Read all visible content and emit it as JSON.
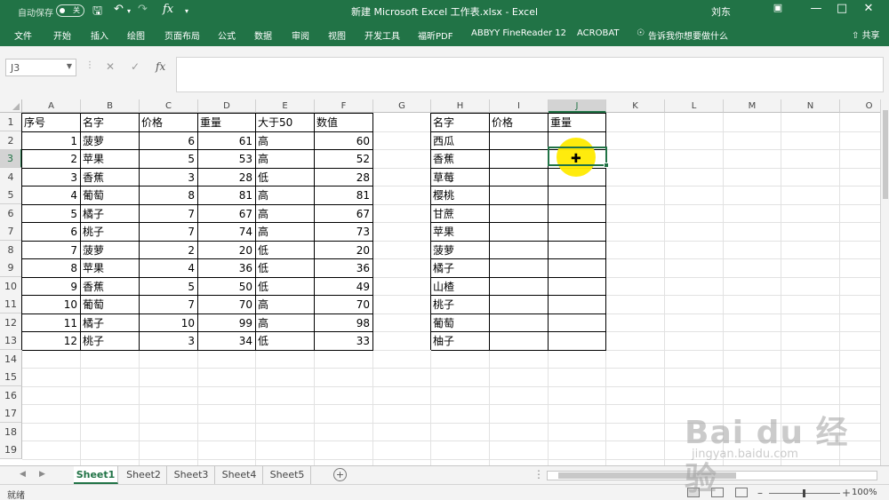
{
  "titlebar": {
    "autosave_label": "自动保存",
    "autosave_state": "关",
    "title": "新建 Microsoft Excel 工作表.xlsx  -  Excel",
    "user": "刘东",
    "icons": [
      "save-icon",
      "undo-icon",
      "redo-icon",
      "function-icon",
      "customize-icon",
      "ribbon-display-icon",
      "minimize-icon",
      "maximize-icon",
      "close-icon"
    ]
  },
  "ribbon": {
    "tabs": [
      "文件",
      "开始",
      "插入",
      "绘图",
      "页面布局",
      "公式",
      "数据",
      "审阅",
      "视图",
      "开发工具",
      "福昕PDF",
      "ABBYY FineReader 12",
      "ACROBAT",
      "告诉我你想要做什么"
    ],
    "share": "共享"
  },
  "namebox": {
    "value": "J3"
  },
  "formula": {
    "value": ""
  },
  "columns": [
    "A",
    "B",
    "C",
    "D",
    "E",
    "F",
    "G",
    "H",
    "I",
    "J",
    "K",
    "L",
    "M",
    "N",
    "O"
  ],
  "rows": [
    "1",
    "2",
    "3",
    "4",
    "5",
    "6",
    "7",
    "8",
    "9",
    "10",
    "11",
    "12",
    "13",
    "14",
    "15",
    "16",
    "17",
    "18",
    "19"
  ],
  "table1": {
    "headers": [
      "序号",
      "名字",
      "价格",
      "重量",
      "大于50",
      "数值"
    ],
    "rows": [
      [
        "1",
        "菠萝",
        "6",
        "61",
        "高",
        "60"
      ],
      [
        "2",
        "苹果",
        "5",
        "53",
        "高",
        "52"
      ],
      [
        "3",
        "香蕉",
        "3",
        "28",
        "低",
        "28"
      ],
      [
        "4",
        "葡萄",
        "8",
        "81",
        "高",
        "81"
      ],
      [
        "5",
        "橘子",
        "7",
        "67",
        "高",
        "67"
      ],
      [
        "6",
        "桃子",
        "7",
        "74",
        "高",
        "73"
      ],
      [
        "7",
        "菠萝",
        "2",
        "20",
        "低",
        "20"
      ],
      [
        "8",
        "苹果",
        "4",
        "36",
        "低",
        "36"
      ],
      [
        "9",
        "香蕉",
        "5",
        "50",
        "低",
        "49"
      ],
      [
        "10",
        "葡萄",
        "7",
        "70",
        "高",
        "70"
      ],
      [
        "11",
        "橘子",
        "10",
        "99",
        "高",
        "98"
      ],
      [
        "12",
        "桃子",
        "3",
        "34",
        "低",
        "33"
      ]
    ]
  },
  "table2": {
    "headers": [
      "名字",
      "价格",
      "重量"
    ],
    "names": [
      "西瓜",
      "香蕉",
      "草莓",
      "樱桃",
      "甘蔗",
      "苹果",
      "菠萝",
      "橘子",
      "山楂",
      "桃子",
      "葡萄",
      "柚子"
    ]
  },
  "sheets": [
    "Sheet1",
    "Sheet2",
    "Sheet3",
    "Sheet4",
    "Sheet5"
  ],
  "active_sheet": "Sheet1",
  "status": {
    "ready": "就绪",
    "zoom": "100%"
  },
  "watermark": {
    "line1": "Bai du 经验",
    "line2": "jingyan.baidu.com"
  },
  "colors": {
    "excel_green": "#217346",
    "highlight": "#ffea00"
  }
}
